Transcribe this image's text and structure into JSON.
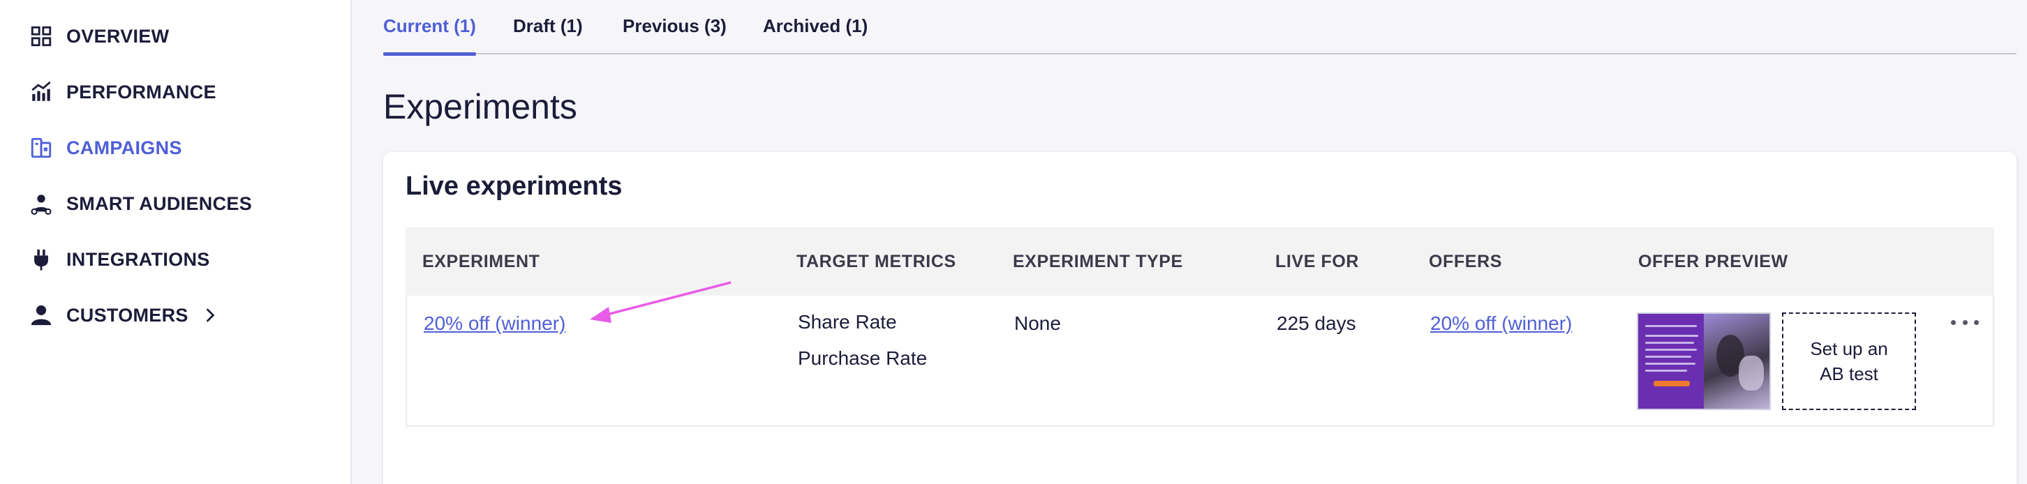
{
  "sidebar": {
    "items": [
      {
        "label": "OVERVIEW",
        "icon": "grid-icon"
      },
      {
        "label": "PERFORMANCE",
        "icon": "chart-icon"
      },
      {
        "label": "CAMPAIGNS",
        "icon": "campaigns-icon",
        "active": true
      },
      {
        "label": "SMART AUDIENCES",
        "icon": "audience-icon"
      },
      {
        "label": "INTEGRATIONS",
        "icon": "plug-icon"
      },
      {
        "label": "CUSTOMERS",
        "icon": "person-icon"
      }
    ]
  },
  "tabs": [
    {
      "label": "Current (1)",
      "active": true
    },
    {
      "label": "Draft (1)"
    },
    {
      "label": "Previous (3)"
    },
    {
      "label": "Archived (1)"
    }
  ],
  "page": {
    "title": "Experiments"
  },
  "card": {
    "title": "Live experiments",
    "columns": [
      "EXPERIMENT",
      "TARGET METRICS",
      "EXPERIMENT TYPE",
      "LIVE FOR",
      "OFFERS",
      "OFFER PREVIEW"
    ],
    "rows": [
      {
        "experiment": "20% off (winner)",
        "metrics": [
          "Share Rate",
          "Purchase Rate"
        ],
        "type": "None",
        "live_for": "225 days",
        "offers": "20% off (winner)",
        "ab_test_label": "Set up an AB test"
      }
    ]
  },
  "colors": {
    "accent": "#4f5fd6",
    "annotation_arrow": "#e85ce8",
    "text": "#1c1c3a"
  }
}
